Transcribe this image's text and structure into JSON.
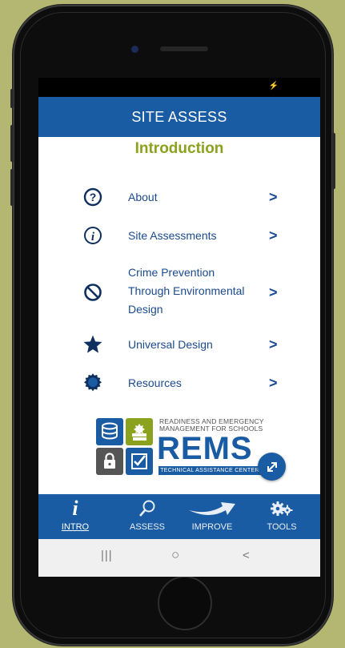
{
  "app": {
    "header_title": "SITE ASSESS",
    "subtitle": "Introduction"
  },
  "menu": {
    "items": [
      {
        "label": "About",
        "icon": "question-circle-icon"
      },
      {
        "label": "Site Assessments",
        "icon": "info-circle-icon"
      },
      {
        "label_lines": [
          "Crime Prevention",
          "Through Environmental",
          "Design"
        ],
        "icon": "prohibited-icon"
      },
      {
        "label": "Universal Design",
        "icon": "star-icon"
      },
      {
        "label": "Resources",
        "icon": "badge-icon"
      }
    ],
    "chevron": ">"
  },
  "logo": {
    "line1": "READINESS AND EMERGENCY",
    "line2": "MANAGEMENT FOR SCHOOLS",
    "name": "REMS",
    "tagline": "TECHNICAL ASSISTANCE CENTER"
  },
  "tabs": [
    {
      "label": "INTRO",
      "icon": "info-italic-icon",
      "active": true
    },
    {
      "label": "ASSESS",
      "icon": "magnifier-icon",
      "active": false
    },
    {
      "label": "IMPROVE",
      "icon": "arrow-icon",
      "active": false
    },
    {
      "label": "TOOLS",
      "icon": "gears-icon",
      "active": false
    }
  ],
  "system_nav": {
    "recents": "|||",
    "home": "○",
    "back": "<"
  },
  "colors": {
    "brand_blue": "#1a5ca3",
    "accent_green": "#8aa21e",
    "background": "#b3b772"
  }
}
